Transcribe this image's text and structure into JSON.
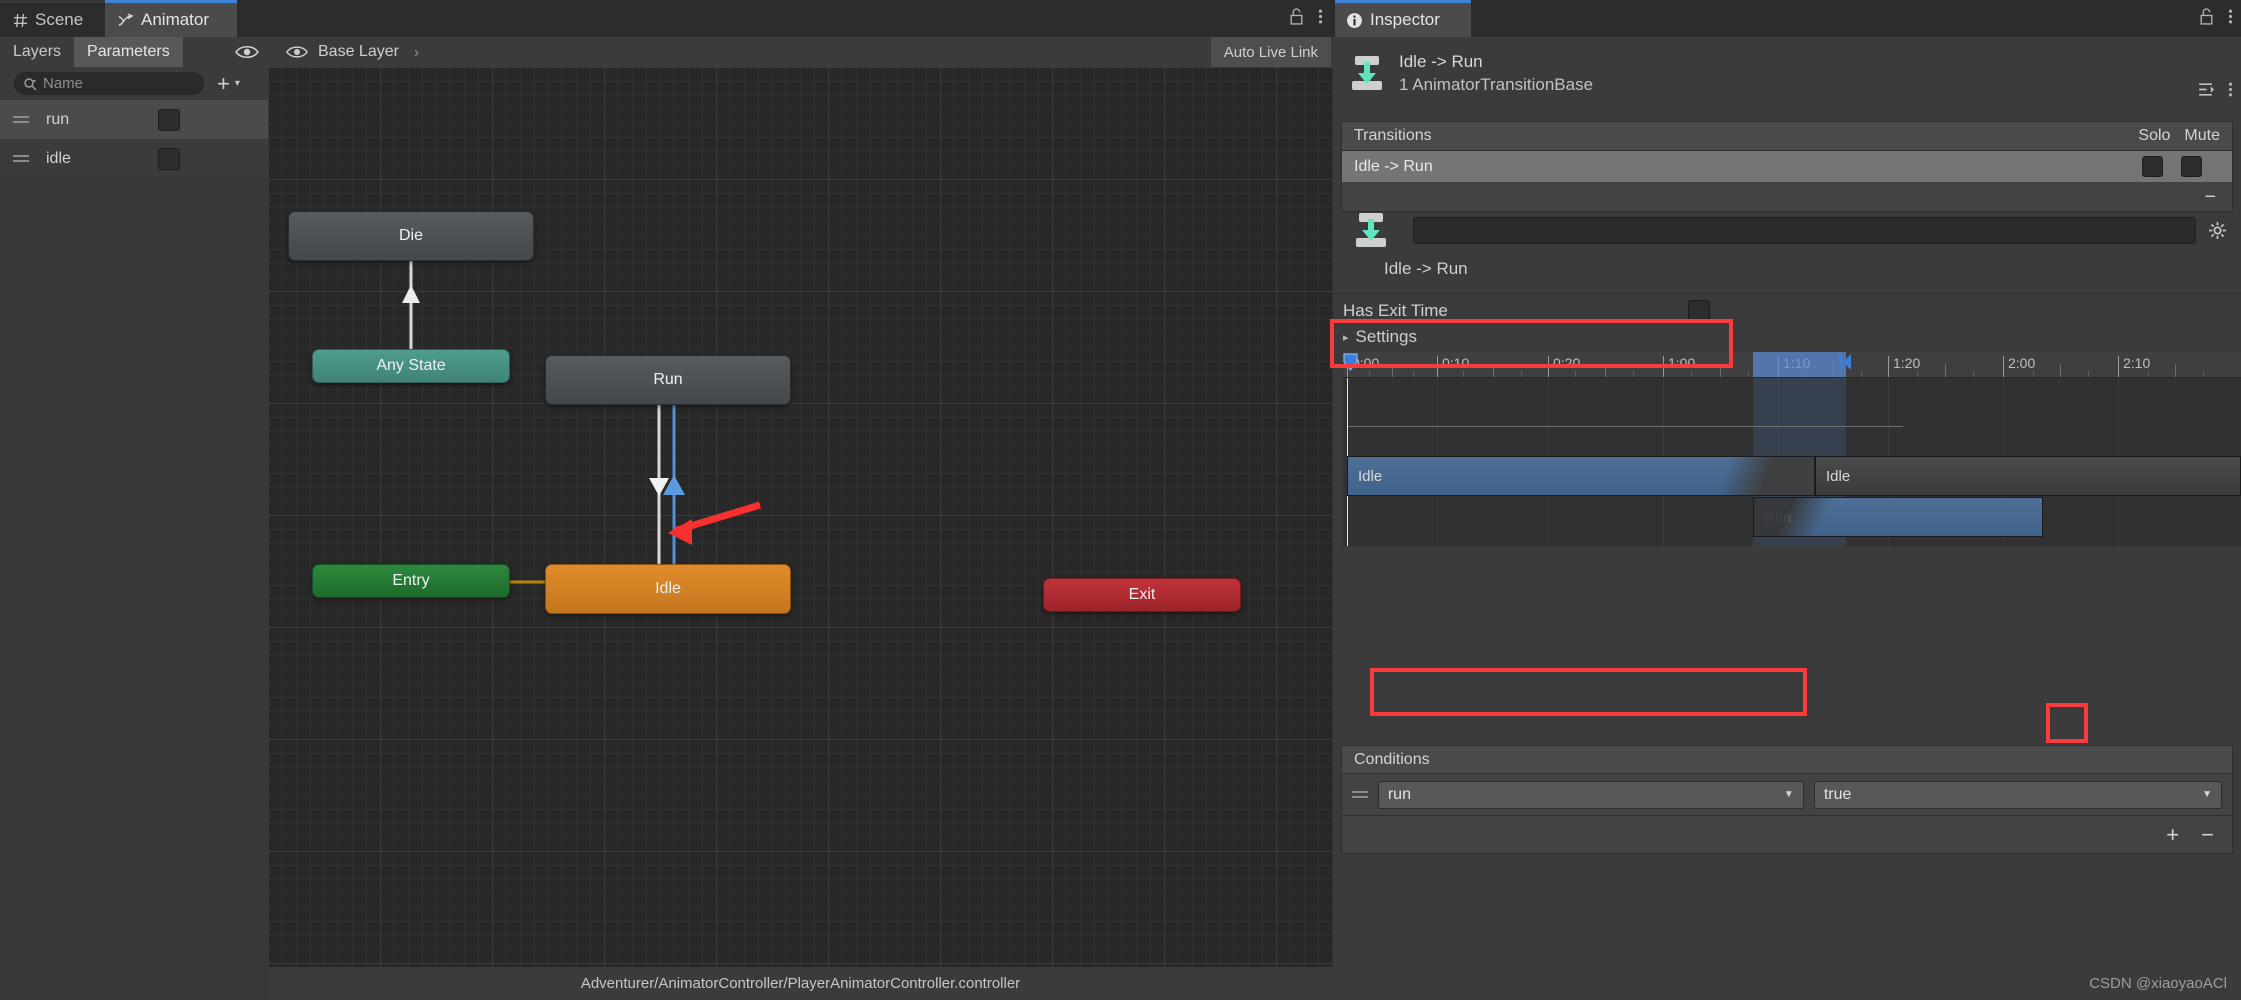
{
  "window": {
    "tabs": [
      {
        "label": "Scene",
        "icon": "grid-icon",
        "active": false
      },
      {
        "label": "Animator",
        "icon": "animator-icon",
        "active": true
      }
    ],
    "lock_icon": "lock-icon",
    "menu_icon": "kebab-menu-icon"
  },
  "sidebar": {
    "tabs": [
      {
        "label": "Layers",
        "active": false
      },
      {
        "label": "Parameters",
        "active": true
      }
    ],
    "eye_icon": "eye-icon",
    "search": {
      "placeholder": "Name",
      "value": "",
      "icon": "search-icon"
    },
    "add_button": "+",
    "add_caret": "▾",
    "parameters": [
      {
        "name": "run",
        "type": "bool",
        "value": false,
        "selected": true
      },
      {
        "name": "idle",
        "type": "bool",
        "value": false,
        "selected": false
      }
    ]
  },
  "graph_toolbar": {
    "eye_icon": "eye-icon",
    "breadcrumb": "Base Layer",
    "breadcrumb_sep": "›",
    "auto_live_link": "Auto Live Link"
  },
  "graph": {
    "nodes": [
      {
        "id": "die",
        "label": "Die",
        "kind": "state"
      },
      {
        "id": "any",
        "label": "Any State",
        "kind": "any"
      },
      {
        "id": "run",
        "label": "Run",
        "kind": "state"
      },
      {
        "id": "idle",
        "label": "Idle",
        "kind": "default-state"
      },
      {
        "id": "entry",
        "label": "Entry",
        "kind": "entry"
      },
      {
        "id": "exit",
        "label": "Exit",
        "kind": "exit"
      }
    ],
    "transitions": [
      {
        "from": "any",
        "to": "die",
        "color": "#d8d8d8",
        "selected": false
      },
      {
        "from": "run",
        "to": "idle",
        "color": "#d8d8d8",
        "selected": false
      },
      {
        "from": "idle",
        "to": "run",
        "color": "#4f90d8",
        "selected": true
      },
      {
        "from": "entry",
        "to": "idle",
        "color": "#b8860b",
        "selected": false
      }
    ],
    "annotation_arrow": "red-pointer-arrow"
  },
  "status_bar": {
    "path": "Adventurer/AnimatorController/PlayerAnimatorController.controller"
  },
  "inspector": {
    "tab": {
      "label": "Inspector",
      "icon": "info-icon"
    },
    "lock_icon": "lock-icon",
    "menu_icon": "kebab-menu-icon",
    "header": {
      "icon": "animator-transition-icon",
      "title": "Idle -> Run",
      "subtitle": "1 AnimatorTransitionBase",
      "preset_icon": "preset-icon",
      "more_icon": "kebab-menu-icon"
    },
    "transitions_panel": {
      "title": "Transitions",
      "solo_label": "Solo",
      "mute_label": "Mute",
      "items": [
        {
          "label": "Idle -> Run",
          "solo": false,
          "mute": false,
          "selected": true
        }
      ],
      "remove_button": "−"
    },
    "object_field": {
      "icon": "animator-transition-icon",
      "value": "",
      "gear_icon": "gear-icon"
    },
    "transition_name": "Idle -> Run",
    "has_exit_time": {
      "label": "Has Exit Time",
      "checked": false
    },
    "settings": {
      "label": "Settings",
      "expanded": false,
      "arrow_icon": "triangle-right-icon"
    },
    "timeline": {
      "ticks": [
        {
          "label": "0:00",
          "pos": 0.0
        },
        {
          "label": "0:10",
          "pos": 0.1
        },
        {
          "label": "0:20",
          "pos": 0.2
        },
        {
          "label": "1:00",
          "pos": 0.3
        },
        {
          "label": "1:10",
          "pos": 0.4
        },
        {
          "label": "1:20",
          "pos": 0.5
        },
        {
          "label": "2:00",
          "pos": 0.6
        },
        {
          "label": "2:10",
          "pos": 0.7
        }
      ],
      "playhead": "0:00",
      "selection_start": "1:10",
      "selection_end": "1:20",
      "clips": [
        {
          "label": "Idle",
          "track": 0,
          "style": "blue",
          "start": 0.0,
          "end": 0.455
        },
        {
          "label": "Idle",
          "track": 0,
          "style": "grey",
          "start": 0.455,
          "end": 1.0
        },
        {
          "label": "Run",
          "track": 1,
          "style": "blue",
          "start": 0.385,
          "end": 0.7
        }
      ]
    },
    "conditions": {
      "title": "Conditions",
      "rows": [
        {
          "parameter": "run",
          "value": "true"
        }
      ],
      "add_button": "+",
      "remove_button": "−"
    }
  },
  "annotations": {
    "highlight_color": "#fb3b3b",
    "boxes": [
      "has-exit-time",
      "condition-parameter",
      "add-condition"
    ]
  },
  "watermark": "CSDN @xiaoyaoACl"
}
